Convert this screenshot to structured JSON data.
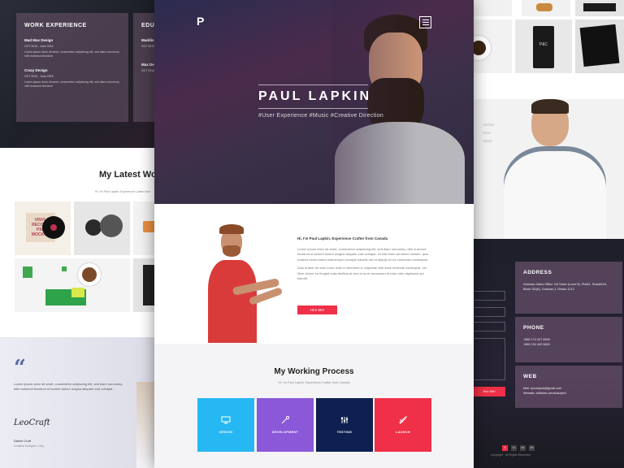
{
  "left": {
    "work": {
      "title": "WORK EXPERIENCE",
      "items": [
        {
          "title": "Mad Max Design",
          "date": "OCT 2013 - June 2014",
          "desc": "Lorem ipsum dolor sit amet, consectetur adipiscing elit, sed diam nonummy nibh euismod tincidunt"
        },
        {
          "title": "Crazy Design",
          "date": "OCT 2014 - June 2015",
          "desc": "Lorem ipsum dolor sit amet, consectetur adipiscing elit, sed diam nonummy nibh euismod tincidunt"
        }
      ]
    },
    "education": {
      "title": "EDUC",
      "items": [
        {
          "title": "Maddis",
          "date": "OCT 2013"
        },
        {
          "title": "Max Des",
          "date": "OCT 2014"
        }
      ]
    },
    "works_title": "My Latest Wor",
    "works_sub": "Hi, I'm Paul Lapkin, Experience Crafter from",
    "vinyl_text": "VINYL RECORD PSD MOCKUP",
    "quote": "Lorem ipsum dolor sit amet, consectetur adipiscing elit, sed diam nonummy nibh euismod tincidunt ut laoreet dolore magna aliquam erat volutpat.",
    "signature": "LeoCraft",
    "author_name": "Daniel Croft",
    "author_role": "Creative Designer, Lexy"
  },
  "center": {
    "logo": "P",
    "name": "PAUL LAPKIN",
    "tags": "#User Experience  #Music  #Creative Direction",
    "about_greeting": "Hi, I'm Paul Lapkin, Experience Crafter from Canada",
    "about_p1": "Lorem ipsum dolor sit amet, consectetur adipiscing elit, sed diam nonummy nibh euismod tincidunt ut laoreet dolore magna aliquam erat volutpat. Ut wisi enim ad minim veniam, quis nostrud exerci tation ullamcorper suscipit lobortis nisl ut aliquip ex ea commodo consequat.",
    "about_p2": "Duis autem vel eum iriure dolor in hendrerit in vulputate velit esse molestie consequat, vel illum dolore eu feugiat nulla facilisis at vero eros et accumsan et iusto odio dignissim qui blandit.",
    "hire_label": "Hire Me!",
    "process_title": "My Working Process",
    "process_sub": "Hi, I'm Paul Lapkin, Experience Crafter from Canada",
    "steps": [
      {
        "label": "DESIGN",
        "color": "#26b8f2",
        "icon": "monitor-icon"
      },
      {
        "label": "DEVELOPMENT",
        "color": "#8a58d8",
        "icon": "pen-icon"
      },
      {
        "label": "TESTING",
        "color": "#0d2051",
        "icon": "sliders-icon"
      },
      {
        "label": "LAUNCH",
        "color": "#ef3048",
        "icon": "rocket-icon"
      }
    ]
  },
  "right": {
    "cup_text": "P&C",
    "address_title": "ADDRESS",
    "address_text": "Gulshan Gates Office: 5A Tower (Level 5), Plot#1, Road#116, Block SD(A), Gulshan-1, Dhaka 1212",
    "phone_title": "PHONE",
    "phone_lines": [
      "+880 174 027 8900",
      "+880 151 440 5800"
    ],
    "web_title": "WEB",
    "web_lines": [
      "Mail: quickayed@gmail.com",
      "Website: dribbble.com/sdsayed"
    ],
    "send_label": "Hire Me!",
    "social": [
      "f",
      "in",
      "be",
      "db"
    ],
    "copyright": "Copyright · All Rights Reserved"
  },
  "colors": {
    "accent": "#ef3048",
    "purple_card": "#7d5f7d",
    "dark_bg": "#1d1f2a"
  }
}
